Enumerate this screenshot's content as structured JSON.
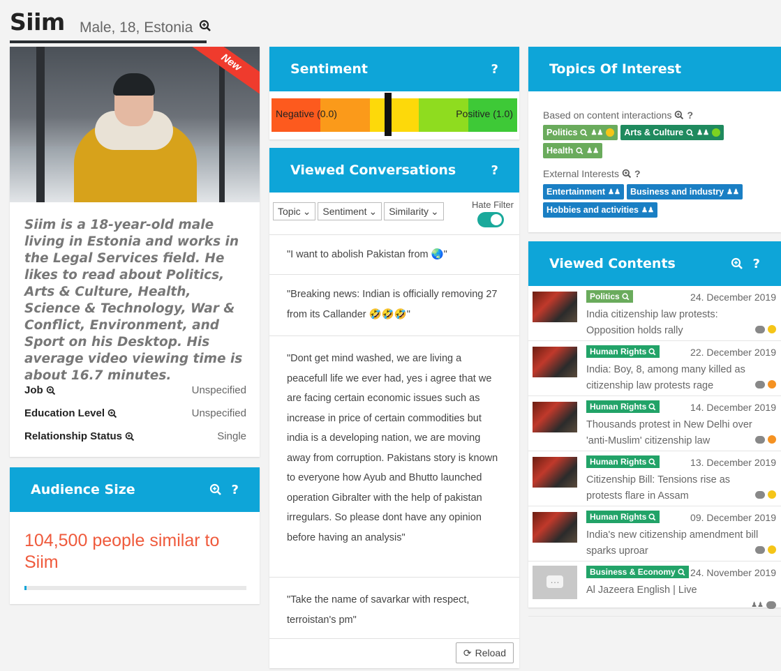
{
  "header": {
    "name": "Siim",
    "demographics": "Male, 18, Estonia"
  },
  "profile": {
    "ribbon": "New",
    "bio": "Siim is a 18-year-old male living in Estonia and works in the Legal Services field. He likes to read about Politics, Arts & Culture, Health, Science & Technology, War & Conflict, Environment, and Sport on his Desktop. His average video viewing time is about 16.7 minutes.",
    "attributes": [
      {
        "label": "Job",
        "value": "Unspecified"
      },
      {
        "label": "Education Level",
        "value": "Unspecified"
      },
      {
        "label": "Relationship Status",
        "value": "Single"
      }
    ]
  },
  "audience": {
    "title": "Audience Size",
    "value_text": "104,500 people similar to Siim",
    "progress": 0.01
  },
  "sentiment": {
    "title": "Sentiment",
    "negative_label": "Negative (0.0)",
    "positive_label": "Positive (1.0)",
    "marker_value": 0.5,
    "colors": [
      "#fd5a1e",
      "#fb9a1a",
      "#fdd90a",
      "#8fdc1f",
      "#3ec937"
    ]
  },
  "conversations": {
    "title": "Viewed Conversations",
    "filters": [
      "Topic",
      "Sentiment",
      "Similarity"
    ],
    "hate_filter_label": "Hate Filter",
    "hate_filter_on": true,
    "items": [
      "\"I want to abolish Pakistan from 🌏\"",
      "\"Breaking news: Indian is officially removing 27 from its Callander 🤣🤣🤣\"",
      "\"Dont get mind washed, we are living a peacefull life we ever had, yes i agree that we are facing certain economic issues such as increase in price of certain commodities but india is a developing nation, we are moving away from corruption. Pakistans story is known to everyone how Ayub and Bhutto launched operation Gibralter with the help of pakistan irregulars. So please dont have any opinion before having an analysis\"",
      "\"Take the name of savarkar with respect, terroistan's pm\""
    ],
    "reload_label": "Reload"
  },
  "topics": {
    "title": "Topics Of Interest",
    "content_label": "Based on content interactions",
    "content_chips": [
      {
        "label": "Politics",
        "color": "green",
        "sentiment": "y"
      },
      {
        "label": "Arts & Culture",
        "color": "teal",
        "sentiment": "g"
      },
      {
        "label": "Health",
        "color": "green",
        "sentiment": null
      }
    ],
    "external_label": "External Interests",
    "external_chips": [
      "Entertainment",
      "Business and industry",
      "Hobbies and activities"
    ]
  },
  "contents": {
    "title": "Viewed Contents",
    "items": [
      {
        "tag": "Politics",
        "tag_color": "g",
        "date": "24. December 2019",
        "title": "India citizenship law protests: Opposition holds rally",
        "sentiment": "y",
        "live": false
      },
      {
        "tag": "Human Rights",
        "tag_color": "t",
        "date": "22. December 2019",
        "title": "India: Boy, 8, among many killed as citizenship law protests rage",
        "sentiment": "o",
        "live": false
      },
      {
        "tag": "Human Rights",
        "tag_color": "t",
        "date": "14. December 2019",
        "title": "Thousands protest in New Delhi over 'anti-Muslim' citizenship law",
        "sentiment": "o",
        "live": false
      },
      {
        "tag": "Human Rights",
        "tag_color": "t",
        "date": "13. December 2019",
        "title": "Citizenship Bill: Tensions rise as protests flare in Assam",
        "sentiment": "y",
        "live": false
      },
      {
        "tag": "Human Rights",
        "tag_color": "t",
        "date": "09. December 2019",
        "title": "India's new citizenship amendment bill sparks uproar",
        "sentiment": "y",
        "live": false
      },
      {
        "tag": "Business & Economy",
        "tag_color": "t",
        "date": "24. November 2019",
        "title": "Al Jazeera English | Live",
        "sentiment": null,
        "live": true
      }
    ]
  }
}
